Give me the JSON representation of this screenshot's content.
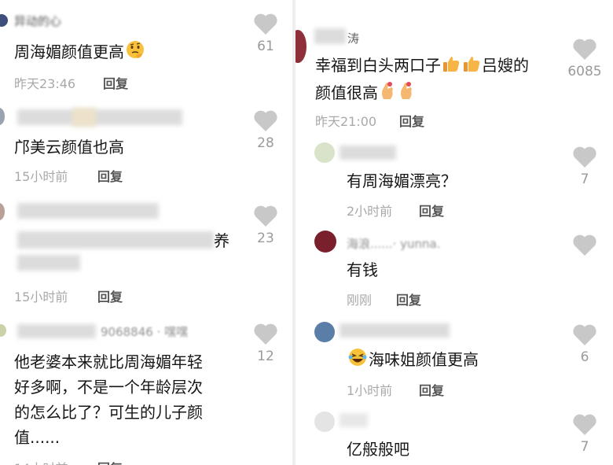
{
  "left": {
    "comments": [
      {
        "username": "异动的心",
        "text": "周海媚颜值更高",
        "emoji": "thinking-face",
        "time": "昨天23:46",
        "reply": "回复",
        "likes": "61"
      },
      {
        "username": "",
        "text": "邝美云颜值也高",
        "time": "15小时前",
        "reply": "回复",
        "likes": "28"
      },
      {
        "username": "",
        "text_tail": "养",
        "time": "15小时前",
        "reply": "回复",
        "likes": "23"
      },
      {
        "username": "9068846 · 嘿嘿",
        "lines": [
          "他老婆本来就比周海媚年轻",
          "好多啊，不是一个年龄层次",
          "的怎么比了？可生的儿子颜",
          "值......"
        ],
        "time": "14小时前",
        "reply": "回复",
        "likes": "12"
      }
    ]
  },
  "right": {
    "comments": [
      {
        "username": "涛",
        "lines": [
          "幸福到白头两口子",
          "吕嫂的",
          "颜值很高"
        ],
        "time": "昨天21:00",
        "reply": "回复",
        "likes": "6085"
      },
      {
        "username": "",
        "text": "有周海媚漂亮？",
        "time": "2小时前",
        "reply": "回复",
        "likes": "7"
      },
      {
        "username": "海浪......· yunna.",
        "text": "有钱",
        "time": "刚刚",
        "reply": "回复",
        "likes": ""
      },
      {
        "username": "",
        "text": "海味姐颜值更高",
        "emoji": "laughing-face",
        "time": "1小时前",
        "reply": "回复",
        "likes": "6"
      },
      {
        "username": "",
        "text": "亿般般吧",
        "time": "",
        "reply": "",
        "likes": "7"
      }
    ]
  },
  "colors": {
    "heart": "#c8c8c8",
    "text": "#161616",
    "meta": "#a9a9a9",
    "reply": "#565656"
  }
}
